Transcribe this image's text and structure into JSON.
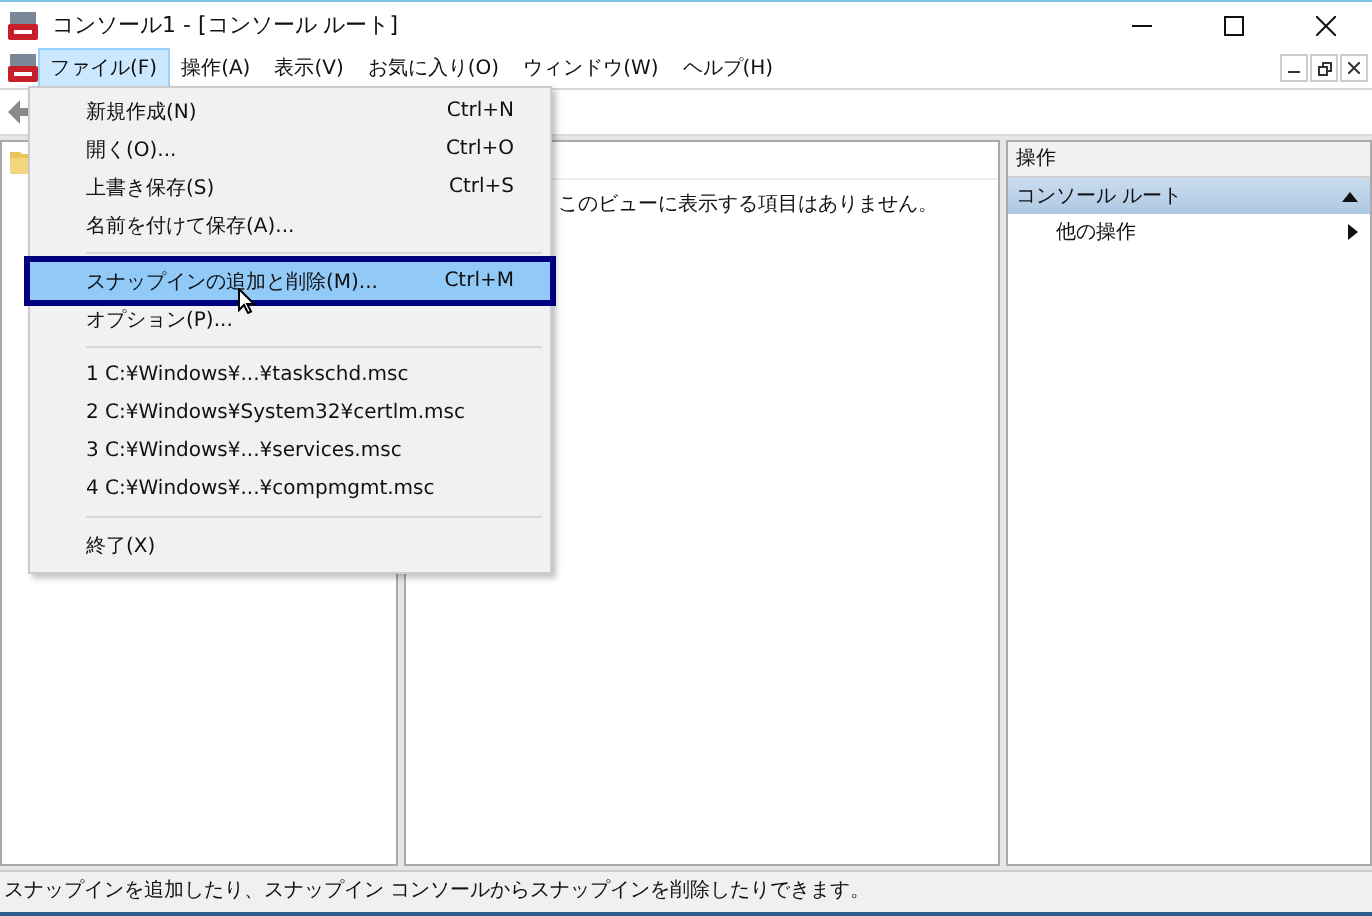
{
  "window": {
    "title": "コンソール1 - [コンソール ルート]"
  },
  "menubar": [
    {
      "label": "ファイル(F)",
      "selected": true
    },
    {
      "label": "操作(A)",
      "selected": false
    },
    {
      "label": "表示(V)",
      "selected": false
    },
    {
      "label": "お気に入り(O)",
      "selected": false
    },
    {
      "label": "ウィンドウ(W)",
      "selected": false
    },
    {
      "label": "ヘルプ(H)",
      "selected": false
    }
  ],
  "file_menu": [
    {
      "kind": "item",
      "label": "新規作成(N)",
      "shortcut": "Ctrl+N",
      "selected": false
    },
    {
      "kind": "item",
      "label": "開く(O)...",
      "shortcut": "Ctrl+O",
      "selected": false
    },
    {
      "kind": "item",
      "label": "上書き保存(S)",
      "shortcut": "Ctrl+S",
      "selected": false
    },
    {
      "kind": "item",
      "label": "名前を付けて保存(A)...",
      "selected": false
    },
    {
      "kind": "separator"
    },
    {
      "kind": "item",
      "label": "スナップインの追加と削除(M)...",
      "shortcut": "Ctrl+M",
      "selected": true
    },
    {
      "kind": "item",
      "label": "オプション(P)...",
      "selected": false
    },
    {
      "kind": "separator"
    },
    {
      "kind": "item",
      "label": "1 C:¥Windows¥...¥taskschd.msc",
      "selected": false
    },
    {
      "kind": "item",
      "label": "2 C:¥Windows¥System32¥certlm.msc",
      "selected": false
    },
    {
      "kind": "item",
      "label": "3 C:¥Windows¥...¥services.msc",
      "selected": false
    },
    {
      "kind": "item",
      "label": "4 C:¥Windows¥...¥compmgmt.msc",
      "selected": false
    },
    {
      "kind": "separator"
    },
    {
      "kind": "item",
      "label": "終了(X)",
      "selected": false
    }
  ],
  "center_pane": {
    "message": "このビューに表示する項目はありません。"
  },
  "actions_pane": {
    "title": "操作",
    "section": {
      "label": "コンソール ルート",
      "expanded": true,
      "items": [
        "他の操作"
      ]
    }
  },
  "status_bar": "スナップインを追加したり、スナップイン コンソールからスナップインを削除したりできます。"
}
